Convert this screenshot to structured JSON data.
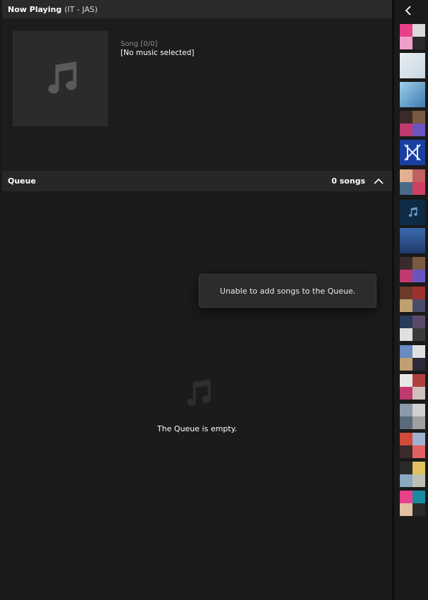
{
  "now_playing": {
    "title": "Now Playing",
    "subtitle": "(IT - JAS)",
    "song_counter": "Song [0/0]",
    "song_title": "[No music selected]"
  },
  "queue": {
    "title": "Queue",
    "count": "0 songs",
    "empty_text": "The Queue is empty."
  },
  "toast": {
    "message": "Unable to add songs to the Queue."
  },
  "icons": {
    "album_placeholder": "music-note-icon",
    "collapse": "chevron-up-icon",
    "back": "chevron-left-icon"
  },
  "colors": {
    "background": "#1b1b1b",
    "header": "#2a2a2a",
    "text": "#ffffff",
    "muted": "#8b8b8b"
  }
}
